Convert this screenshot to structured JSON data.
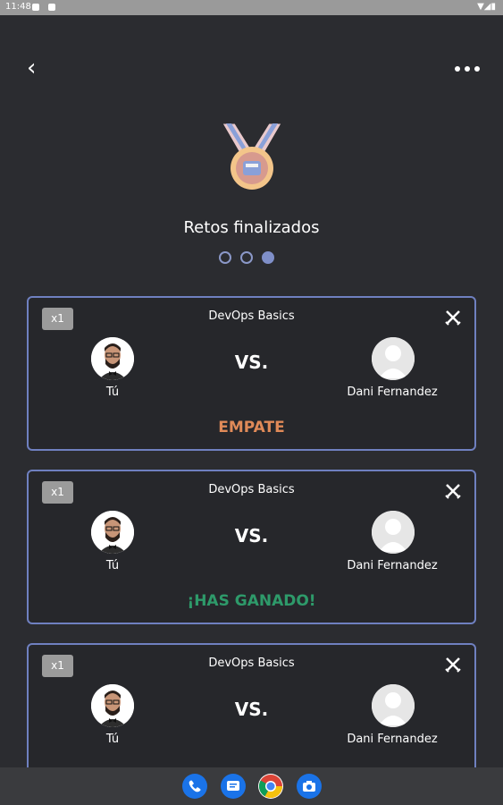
{
  "status_bar": {
    "time": "11:48"
  },
  "header": {
    "title": "Retos finalizados"
  },
  "pagination": {
    "pages": 3,
    "active": 3
  },
  "cards": [
    {
      "badge": "x1",
      "course": "DevOps Basics",
      "player_left": "Tú",
      "vs": "VS.",
      "player_right": "Dani Fernandez",
      "result": "EMPATE",
      "result_color": "#e08a58"
    },
    {
      "badge": "x1",
      "course": "DevOps Basics",
      "player_left": "Tú",
      "vs": "VS.",
      "player_right": "Dani Fernandez",
      "result": "¡HAS GANADO!",
      "result_color": "#2e9a6a"
    },
    {
      "badge": "x1",
      "course": "DevOps Basics",
      "player_left": "Tú",
      "vs": "VS.",
      "player_right": "Dani Fernandez",
      "result": "",
      "result_color": "#ffffff"
    }
  ],
  "colors": {
    "background": "#2b2c30",
    "card_border": "#6f80c0",
    "accent": "#7f8fc8"
  },
  "icons": {
    "back": "back-arrow-icon",
    "more": "more-dots-icon",
    "medal": "medal-icon",
    "close": "swords-icon",
    "phone": "phone-icon",
    "messages": "messages-icon",
    "chrome": "chrome-icon",
    "camera": "camera-icon"
  }
}
